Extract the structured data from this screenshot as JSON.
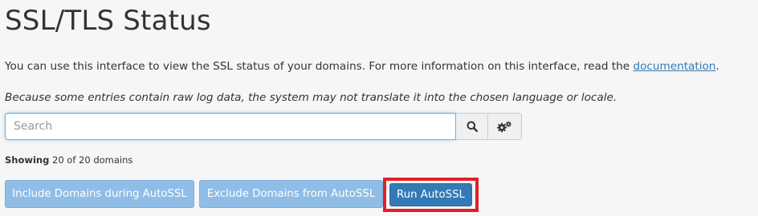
{
  "page": {
    "title": "SSL/TLS Status",
    "intro_text": "You can use this interface to view the SSL status of your domains. For more information on this interface, read the ",
    "documentation_link": "documentation",
    "intro_end": ".",
    "note": "Because some entries contain raw log data, the system may not translate it into the chosen language or locale."
  },
  "search": {
    "placeholder": "Search",
    "value": "",
    "search_icon": "search-icon",
    "settings_icon": "cogs-icon"
  },
  "showing": {
    "label": "Showing",
    "text": "20 of 20 domains"
  },
  "actions": {
    "include_label": "Include Domains during AutoSSL",
    "exclude_label": "Exclude Domains from AutoSSL",
    "run_label": "Run AutoSSL"
  },
  "colors": {
    "accent": "#337ab7",
    "disabled_button": "#8fbde6",
    "highlight": "#e31f26",
    "focus_border": "#66afe9"
  }
}
